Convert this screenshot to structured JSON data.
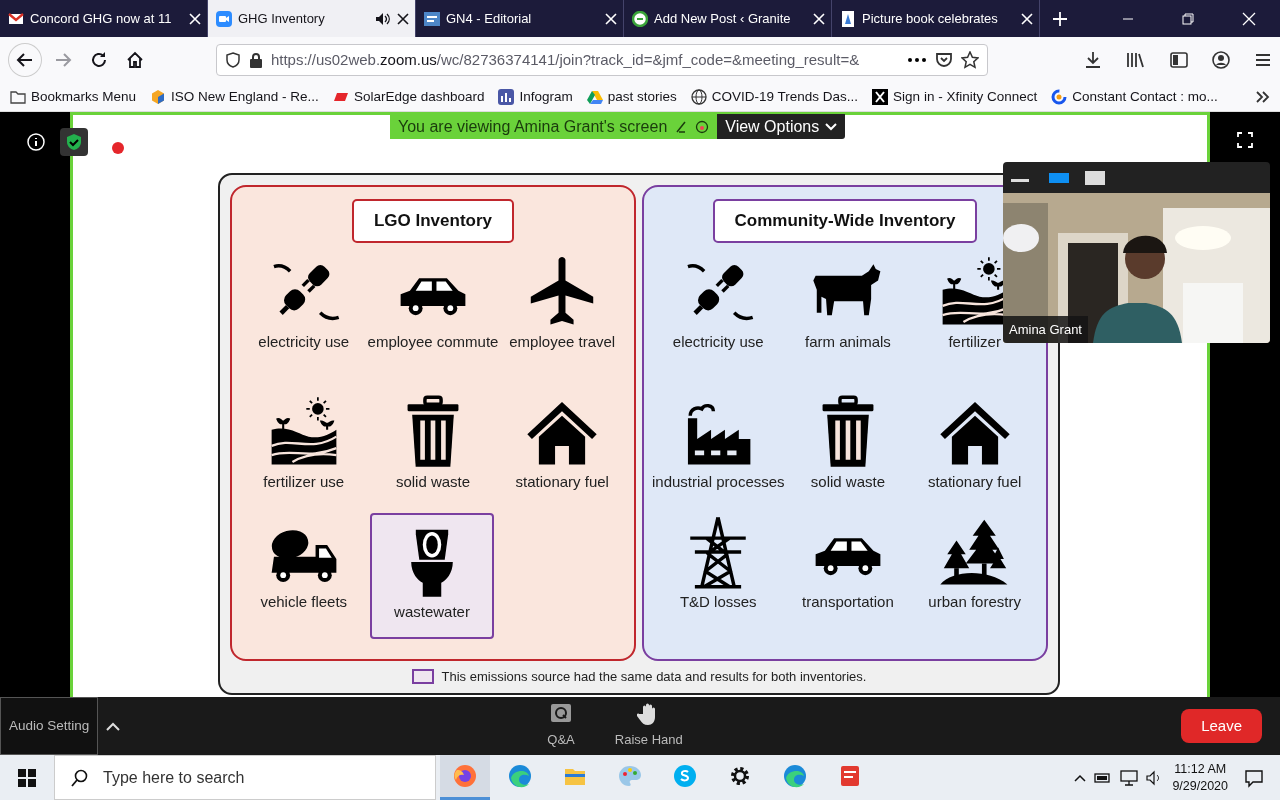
{
  "browser": {
    "tabs": [
      {
        "title": "Concord GHG now at 11",
        "selected": false,
        "audio": false
      },
      {
        "title": "GHG Inventory",
        "selected": true,
        "audio": true
      },
      {
        "title": "GN4 - Editorial",
        "selected": false,
        "audio": false
      },
      {
        "title": "Add New Post ‹ Granite",
        "selected": false,
        "audio": false
      },
      {
        "title": "Picture book celebrates",
        "selected": false,
        "audio": false
      }
    ],
    "url": "https://us02web.**zoom.us**/wc/82736374141/join?track_id=&jmf_code=&meeting_result=&",
    "bookmarks": [
      {
        "label": "Bookmarks Menu"
      },
      {
        "label": "ISO New England - Re..."
      },
      {
        "label": "SolarEdge dashboard"
      },
      {
        "label": "Infogram"
      },
      {
        "label": "past stories"
      },
      {
        "label": "COVID-19 Trends Das..."
      },
      {
        "label": "Sign in - Xfinity Connect"
      },
      {
        "label": "Constant Contact : mo..."
      }
    ]
  },
  "meeting": {
    "recording": true,
    "banner": "You are viewing Amina Grant's screen",
    "view_options": "View Options",
    "slide": {
      "panels": [
        {
          "title": "LGO Inventory",
          "items": [
            {
              "label": "electricity use",
              "shared": false
            },
            {
              "label": "employee commute",
              "shared": false
            },
            {
              "label": "employee travel",
              "shared": false
            },
            {
              "label": "fertilizer use",
              "shared": false
            },
            {
              "label": "solid waste",
              "shared": false
            },
            {
              "label": "stationary fuel",
              "shared": false
            },
            {
              "label": "vehicle fleets",
              "shared": false
            },
            {
              "label": "wastewater",
              "shared": true
            }
          ]
        },
        {
          "title": "Community-Wide Inventory",
          "items": [
            {
              "label": "electricity use",
              "shared": false
            },
            {
              "label": "farm animals",
              "shared": false
            },
            {
              "label": "fertilizer",
              "shared": false
            },
            {
              "label": "industrial processes",
              "shared": false
            },
            {
              "label": "solid waste",
              "shared": false
            },
            {
              "label": "stationary fuel",
              "shared": false
            },
            {
              "label": "T&D losses",
              "shared": false
            },
            {
              "label": "transportation",
              "shared": false
            },
            {
              "label": "urban forestry",
              "shared": false
            }
          ]
        }
      ],
      "legend": "This emissions source had the same data and results for both inventories."
    },
    "video": {
      "name": "Amina Grant",
      "view_buttons": [
        {
          "selected": true
        },
        {
          "selected": false
        }
      ]
    },
    "controls": {
      "audio_setting": "Audio Setting",
      "actions": [
        {
          "label": "Q&A"
        },
        {
          "label": "Raise Hand"
        }
      ],
      "leave": "Leave"
    }
  },
  "taskbar": {
    "search_placeholder": "Type here to search",
    "apps": [
      {
        "active": true
      },
      {
        "active": false
      },
      {
        "active": false
      },
      {
        "active": false
      },
      {
        "active": false
      },
      {
        "active": false
      },
      {
        "active": false
      },
      {
        "active": false
      }
    ],
    "time": "11:12 AM",
    "date": "9/29/2020"
  }
}
